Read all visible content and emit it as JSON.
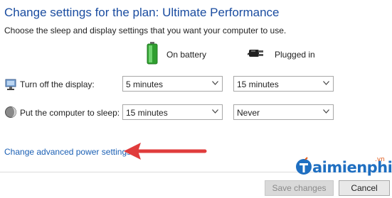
{
  "header": {
    "title": "Change settings for the plan: Ultimate Performance",
    "subtitle": "Choose the sleep and display settings that you want your computer to use."
  },
  "columns": {
    "battery_label": "On battery",
    "plugged_label": "Plugged in"
  },
  "rows": [
    {
      "label": "Turn off the display:",
      "battery_value": "5 minutes",
      "plugged_value": "15 minutes"
    },
    {
      "label": "Put the computer to sleep:",
      "battery_value": "15 minutes",
      "plugged_value": "Never"
    }
  ],
  "advanced_link": "Change advanced power settings",
  "buttons": {
    "save_label": "Save changes",
    "cancel_label": "Cancel"
  },
  "watermark": {
    "logo_text": "aimienphi",
    "suffix": ".vn"
  },
  "colors": {
    "title": "#1a4ca0",
    "link": "#1a5fb4",
    "arrow": "#e03c3c",
    "battery": "#3cb43c"
  }
}
